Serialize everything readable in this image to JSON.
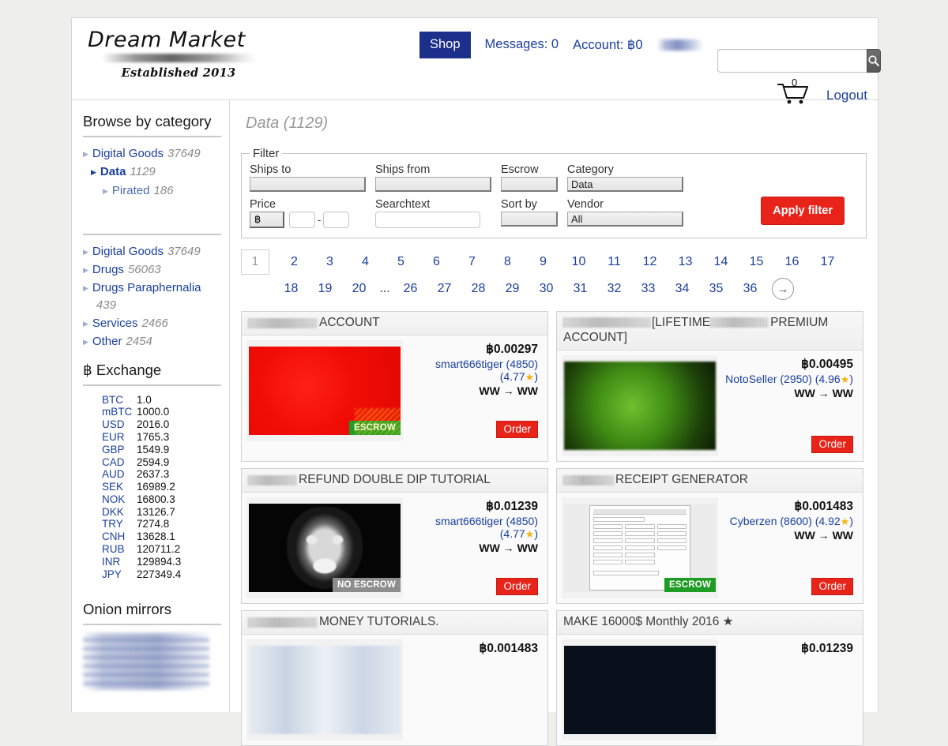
{
  "header": {
    "logo_title": "Dream Market",
    "logo_sub": "Established 2013",
    "shop_label": "Shop",
    "messages_label": "Messages: 0",
    "account_label": "Account: ฿0",
    "search_placeholder": "",
    "search_value": "",
    "cart_count": "0",
    "logout_label": "Logout"
  },
  "sidebar": {
    "browse_heading": "Browse by category",
    "active_tree": [
      {
        "label": "Digital Goods",
        "count": "37649",
        "level": 1,
        "selected": false
      },
      {
        "label": "Data",
        "count": "1129",
        "level": 2,
        "selected": true
      },
      {
        "label": "Pirated",
        "count": "186",
        "level": 3,
        "selected": false
      }
    ],
    "all_categories": [
      {
        "label": "Digital Goods",
        "count": "37649"
      },
      {
        "label": "Drugs",
        "count": "56063"
      },
      {
        "label": "Drugs Paraphernalia",
        "count": "439"
      },
      {
        "label": "Services",
        "count": "2466"
      },
      {
        "label": "Other",
        "count": "2454"
      }
    ],
    "exchange_heading": "฿ Exchange",
    "exchange_rates": [
      {
        "currency": "BTC",
        "value": "1.0"
      },
      {
        "currency": "mBTC",
        "value": "1000.0"
      },
      {
        "currency": "USD",
        "value": "2016.0"
      },
      {
        "currency": "EUR",
        "value": "1765.3"
      },
      {
        "currency": "GBP",
        "value": "1549.9"
      },
      {
        "currency": "CAD",
        "value": "2594.9"
      },
      {
        "currency": "AUD",
        "value": "2637.3"
      },
      {
        "currency": "SEK",
        "value": "16989.2"
      },
      {
        "currency": "NOK",
        "value": "16800.3"
      },
      {
        "currency": "DKK",
        "value": "13126.7"
      },
      {
        "currency": "TRY",
        "value": "7274.8"
      },
      {
        "currency": "CNH",
        "value": "13628.1"
      },
      {
        "currency": "RUB",
        "value": "120711.2"
      },
      {
        "currency": "INR",
        "value": "129894.3"
      },
      {
        "currency": "JPY",
        "value": "227349.4"
      }
    ],
    "onion_heading": "Onion mirrors"
  },
  "main": {
    "page_title": "Data (1129)",
    "filter": {
      "legend": "Filter",
      "ships_to_label": "Ships to",
      "ships_to_value": "",
      "ships_from_label": "Ships from",
      "ships_from_value": "",
      "escrow_label": "Escrow",
      "escrow_value": "",
      "category_label": "Category",
      "category_value": "Data",
      "price_label": "Price",
      "price_currency": "฿",
      "price_min": "",
      "price_max": "",
      "searchtext_label": "Searchtext",
      "searchtext_value": "",
      "sort_by_label": "Sort by",
      "sort_by_value": "",
      "vendor_label": "Vendor",
      "vendor_value": "All",
      "apply_label": "Apply filter"
    },
    "pagination": {
      "current": "1",
      "row1": [
        "2",
        "3",
        "4",
        "5",
        "6",
        "7",
        "8",
        "9",
        "10",
        "11",
        "12",
        "13",
        "14",
        "15",
        "16",
        "17"
      ],
      "row2": [
        "18",
        "19",
        "20",
        "...",
        "26",
        "27",
        "28",
        "29",
        "30",
        "31",
        "32",
        "33",
        "34",
        "35",
        "36"
      ],
      "next_icon": "→"
    },
    "products": [
      {
        "title_visible": "ACCOUNT",
        "title_redacted": true,
        "redact_width": 88,
        "price": "฿0.00297",
        "vendor": "smart666tiger",
        "vendor_sales": "(4850)",
        "vendor_rating": "(4.77",
        "vendor_rating_close": ")",
        "shipping": "WW → WW",
        "escrow_badge": "ESCROW",
        "escrow_type": "escrow",
        "order_label": "Order",
        "thumb": "th-red"
      },
      {
        "title_visible": "[LIFETIME",
        "title_visible2": "PREMIUM ACCOUNT]",
        "title_redacted": true,
        "redact_width": 110,
        "redact_width2": 74,
        "price": "฿0.00495",
        "vendor": "NotoSeller",
        "vendor_sales": "(2950)",
        "vendor_rating": "(4.96",
        "vendor_rating_close": ")",
        "shipping": "WW → WW",
        "escrow_badge": "",
        "escrow_type": "none",
        "order_label": "Order",
        "thumb": "th-green"
      },
      {
        "title_visible": "REFUND DOUBLE DIP TUTORIAL",
        "title_redacted": true,
        "redact_width": 62,
        "price": "฿0.01239",
        "vendor": "smart666tiger",
        "vendor_sales": "(4850)",
        "vendor_rating": "(4.77",
        "vendor_rating_close": ")",
        "shipping": "WW → WW",
        "escrow_badge": "NO ESCROW",
        "escrow_type": "noescrow",
        "order_label": "Order",
        "thumb": "th-mask"
      },
      {
        "title_visible": "RECEIPT GENERATOR",
        "title_redacted": true,
        "redact_width": 64,
        "price": "฿0.001483",
        "vendor": "Cyberzen",
        "vendor_sales": "(8600)",
        "vendor_rating": "(4.92",
        "vendor_rating_close": ")",
        "shipping": "WW → WW",
        "escrow_badge": "ESCROW",
        "escrow_type": "escrow",
        "order_label": "Order",
        "thumb": "th-win"
      },
      {
        "title_visible": "MONEY TUTORIALS.",
        "title_redacted": true,
        "redact_width": 88,
        "price": "฿0.001483",
        "vendor": "",
        "vendor_sales": "",
        "vendor_rating": "",
        "vendor_rating_close": "",
        "shipping": "",
        "escrow_badge": "",
        "escrow_type": "none",
        "order_label": "",
        "thumb": "th-money"
      },
      {
        "title_visible": "MAKE 16000$ Monthly 2016 ★",
        "title_redacted": false,
        "redact_width": 0,
        "price": "฿0.01239",
        "vendor": "",
        "vendor_sales": "",
        "vendor_rating": "",
        "vendor_rating_close": "",
        "shipping": "",
        "escrow_badge": "",
        "escrow_type": "none",
        "order_label": "",
        "thumb": "th-dark"
      }
    ]
  }
}
